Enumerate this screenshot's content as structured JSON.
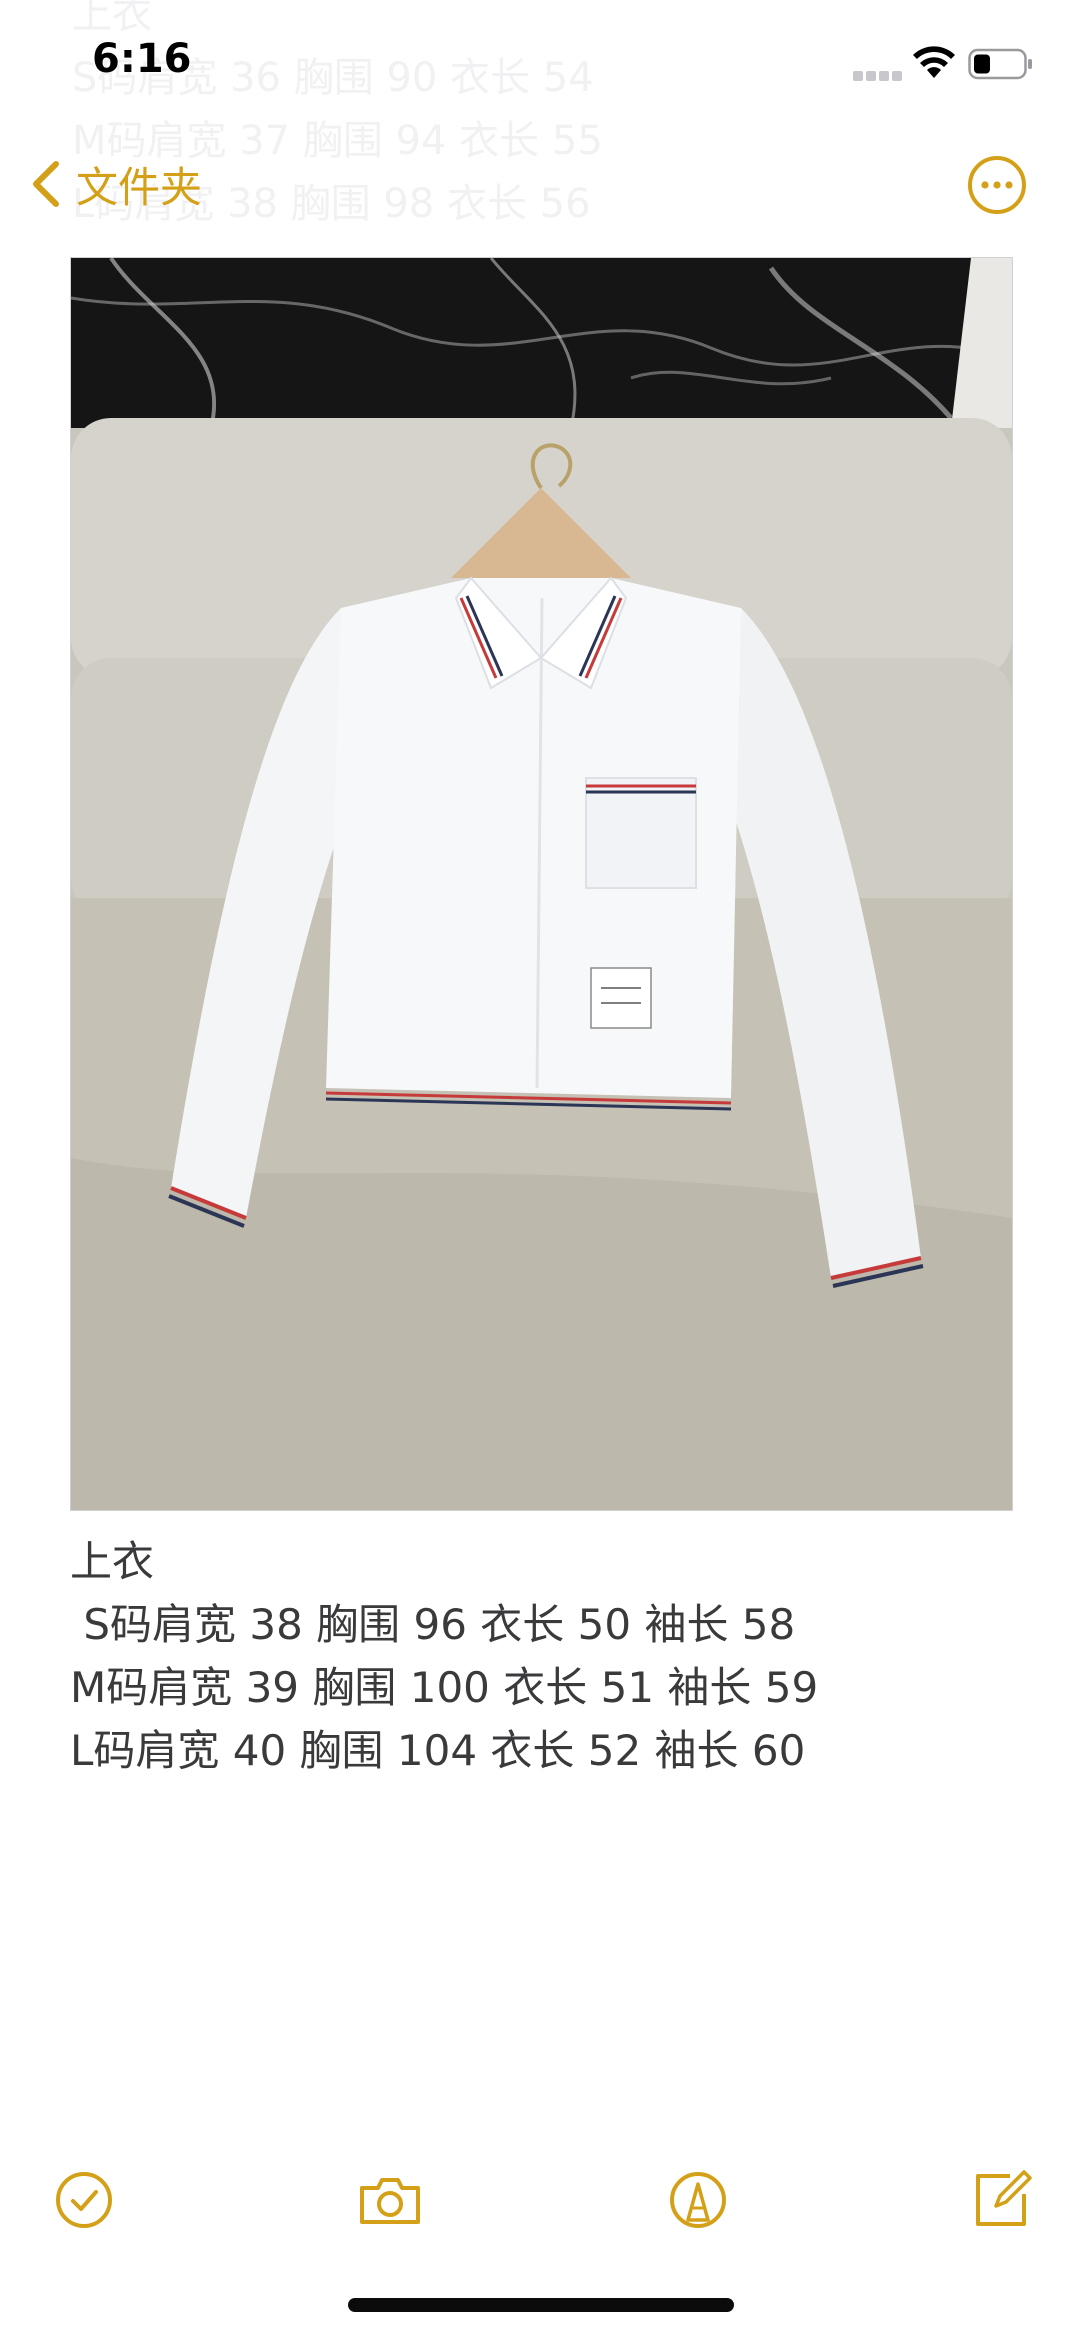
{
  "status_bar": {
    "time": "6:16"
  },
  "background_note": {
    "lines": [
      "上衣",
      "S码肩宽 36 胸围 90 衣长 54",
      "M码肩宽 37 胸围 94 衣长 55",
      "L码肩宽 38 胸围 98 衣长 56"
    ]
  },
  "nav": {
    "back_label": "文件夹",
    "accent_color": "#d4a017"
  },
  "note": {
    "lines": [
      "上衣",
      " S码肩宽 38 胸围 96 衣长 50 袖长 58",
      "M码肩宽 39 胸围 100 衣长 51 袖长 59",
      "L码肩宽 40 胸围 104 衣长 52 袖长 60"
    ]
  },
  "toolbar": {
    "icons": [
      "checklist-icon",
      "camera-icon",
      "markup-icon",
      "compose-icon"
    ]
  }
}
